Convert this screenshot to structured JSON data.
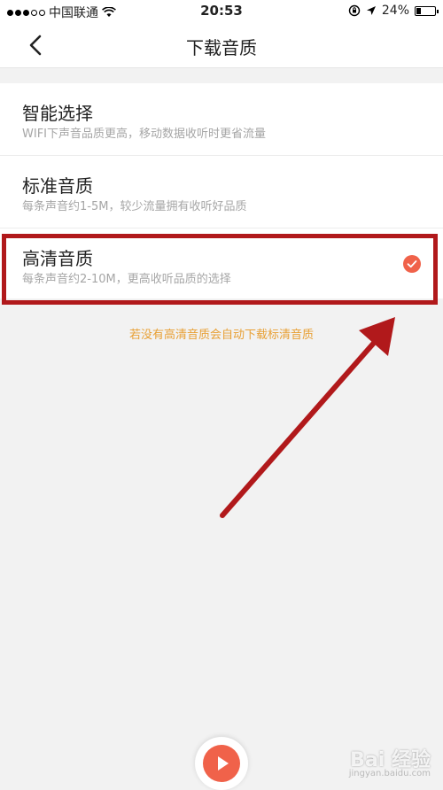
{
  "status_bar": {
    "carrier": "中国联通",
    "time": "20:53",
    "battery_percent": "24%",
    "battery_level": 0.24
  },
  "nav": {
    "title": "下载音质",
    "back_icon": "chevron-left-icon"
  },
  "options": [
    {
      "title": "智能选择",
      "subtitle": "WIFI下声音品质更高，移动数据收听时更省流量",
      "selected": false
    },
    {
      "title": "标准音质",
      "subtitle": "每条声音约1-5M，较少流量拥有收听好品质",
      "selected": false
    },
    {
      "title": "高清音质",
      "subtitle": "每条声音约2-10M，更高收听品质的选择",
      "selected": true
    }
  ],
  "hint": "若没有高清音质会自动下载标清音质",
  "watermark": {
    "text": "Bai 经验",
    "sub": "jingyan.baidu.com"
  },
  "colors": {
    "accent": "#f0624a",
    "hint": "#e8a035",
    "highlight": "#b1191b"
  }
}
